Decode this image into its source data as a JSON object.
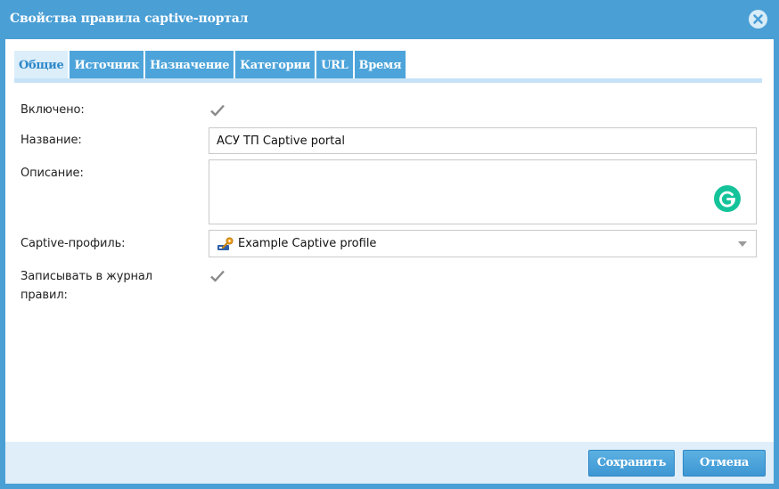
{
  "window": {
    "title": "Свойства правила captive-портал",
    "close_icon": "close-circle-icon"
  },
  "tabs": [
    {
      "label": "Общие",
      "active": true
    },
    {
      "label": "Источник",
      "active": false
    },
    {
      "label": "Назначение",
      "active": false
    },
    {
      "label": "Категории",
      "active": false
    },
    {
      "label": "URL",
      "active": false
    },
    {
      "label": "Время",
      "active": false
    }
  ],
  "form": {
    "enabled": {
      "label": "Включено:",
      "checked": true
    },
    "name": {
      "label": "Название:",
      "value": "АСУ ТП Captive portal"
    },
    "description": {
      "label": "Описание:",
      "value": "",
      "widget_icon": "grammarly-icon"
    },
    "captive_profile": {
      "label": "Captive-профиль:",
      "value": "Example Captive profile",
      "icon": "captive-profile-icon"
    },
    "log": {
      "label_line1": "Записывать в журнал",
      "label_line2": "правил:",
      "checked": true
    }
  },
  "buttons": {
    "save": "Сохранить",
    "cancel": "Отмена"
  },
  "colors": {
    "window_frame": "#4a9fd5",
    "tab": "#4da4da",
    "tab_active_bg": "#dceefa",
    "footer": "#dfeef9",
    "grammarly": "#15c39a"
  }
}
